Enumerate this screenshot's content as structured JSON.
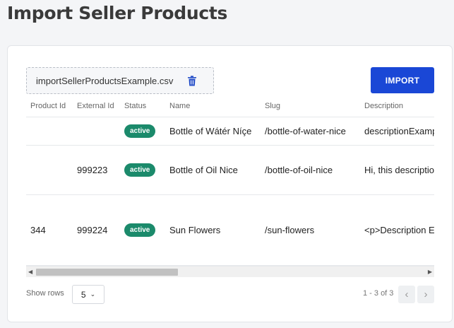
{
  "page": {
    "title": "Import Seller Products"
  },
  "upload": {
    "file_name": "importSellerProductsExample.csv",
    "delete_icon": "trash-icon",
    "import_label": "IMPORT"
  },
  "table": {
    "columns": [
      "Product Id",
      "External Id",
      "Status",
      "Name",
      "Slug",
      "Description"
    ],
    "rows": [
      {
        "product_id": "",
        "external_id": "",
        "status": "active",
        "name": "Bottle of Wátér Níçe",
        "slug": "/bottle-of-water-nice",
        "description": "descriptionExample"
      },
      {
        "product_id": "",
        "external_id": "999223",
        "status": "active",
        "name": "Bottle of Oil Nice",
        "slug": "/bottle-of-oil-nice",
        "description": "Hi, this description"
      },
      {
        "product_id": "344",
        "external_id": "999224",
        "status": "active",
        "name": "Sun Flowers",
        "slug": "/sun-flowers",
        "description": "<p>Description E"
      }
    ]
  },
  "pagination": {
    "show_rows_label": "Show rows",
    "rows_per_page": "5",
    "range_text": "1 - 3 of 3",
    "prev_icon": "chevron-left-icon",
    "next_icon": "chevron-right-icon"
  },
  "colors": {
    "accent": "#1a47d6",
    "active_badge": "#1b8a6b"
  }
}
